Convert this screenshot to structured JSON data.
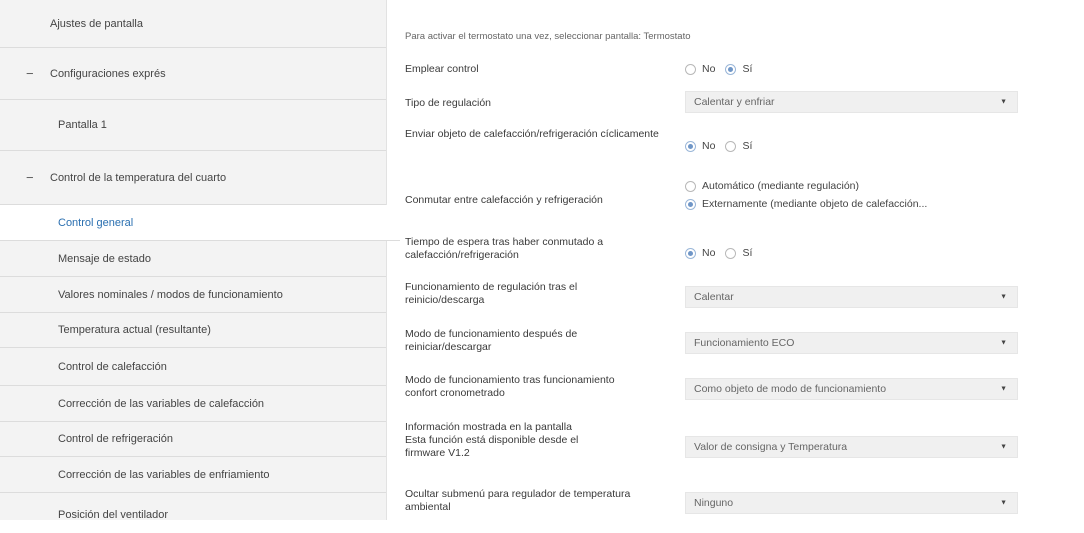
{
  "sidebar": {
    "items": [
      {
        "label": "Ajustes de pantalla"
      },
      {
        "label": "Configuraciones exprés",
        "collapse_icon": "−"
      },
      {
        "label": "Pantalla 1"
      },
      {
        "label": "Control de la temperatura del cuarto",
        "collapse_icon": "−"
      },
      {
        "label": "Control general"
      },
      {
        "label": "Mensaje de estado"
      },
      {
        "label": "Valores nominales / modos de funcionamiento"
      },
      {
        "label": "Temperatura actual (resultante)"
      },
      {
        "label": "Control de calefacción"
      },
      {
        "label": "Corrección de las variables de calefacción"
      },
      {
        "label": "Control de refrigeración"
      },
      {
        "label": "Corrección de las variables de enfriamiento"
      },
      {
        "label": "Posición del ventilador"
      }
    ]
  },
  "main": {
    "info": "Para activar el termostato una vez, seleccionar pantalla: Termostato",
    "emplear_control": {
      "label": "Emplear control",
      "options": [
        "No",
        "Sí"
      ],
      "selected": "Sí"
    },
    "tipo_regulacion": {
      "label": "Tipo de regulación",
      "value": "Calentar y enfriar"
    },
    "enviar_objeto": {
      "label": "Enviar objeto de calefacción/refrigeración cíclicamente",
      "options": [
        "No",
        "Sí"
      ],
      "selected": "No"
    },
    "conmutar": {
      "label": "Conmutar entre calefacción y refrigeración",
      "options": [
        "Automático (mediante regulación)",
        "Externamente (mediante objeto de calefacción..."
      ],
      "selected": "Externamente (mediante objeto de calefacción..."
    },
    "tiempo_espera": {
      "label": "Tiempo de espera tras haber conmutado a calefacción/refrigeración",
      "options": [
        "No",
        "Sí"
      ],
      "selected": "No"
    },
    "funcionamiento_regulacion": {
      "label": "Funcionamiento de regulación tras el reinicio/descarga",
      "value": "Calentar"
    },
    "modo_reiniciar": {
      "label": "Modo de funcionamiento después de reiniciar/descargar",
      "value": "Funcionamiento ECO"
    },
    "modo_confort": {
      "label": "Modo de funcionamiento tras funcionamiento confort cronometrado",
      "value": "Como objeto de modo de funcionamiento"
    },
    "informacion_pantalla": {
      "label_lines": [
        "Información mostrada en la pantalla",
        "Esta función está disponible desde el",
        "firmware V1.2"
      ],
      "value": "Valor de consigna y Temperatura"
    },
    "ocultar_submenu": {
      "label": "Ocultar submenú para regulador de temperatura ambiental",
      "value": "Ninguno"
    }
  },
  "colors": {
    "sidebar_bg": "#f3f3f3",
    "active_text": "#2a6fb0",
    "radio_checked": "#6f96c7",
    "select_bg": "#f0f0f0"
  }
}
